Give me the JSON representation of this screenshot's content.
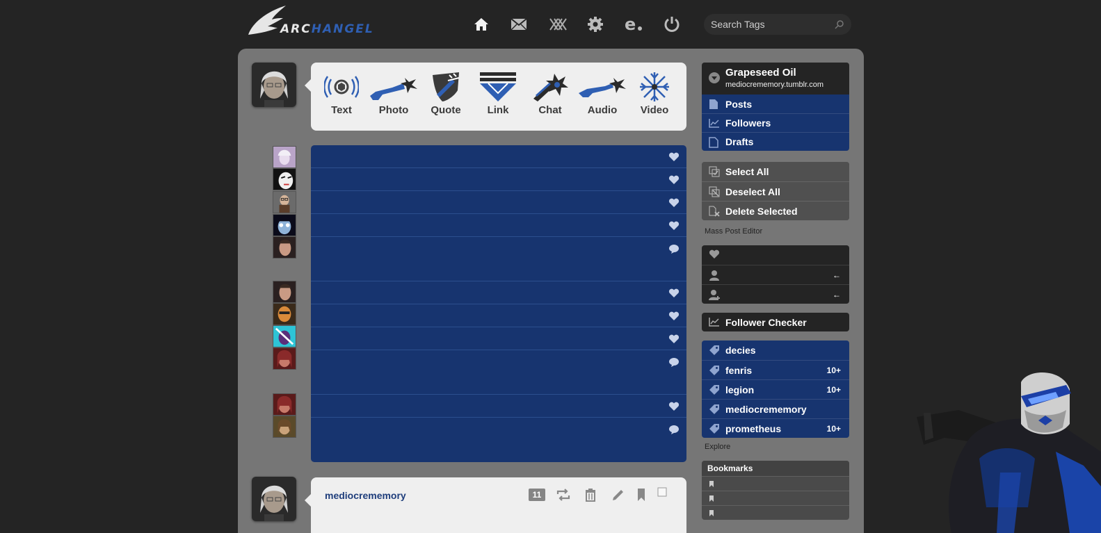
{
  "header": {
    "logo_part1": "ARC",
    "logo_part2": "HANGEL",
    "nav": [
      "home-icon",
      "mail-icon",
      "xkit-icon",
      "gear-icon",
      "e-icon",
      "power-icon"
    ],
    "search_placeholder": "Search Tags"
  },
  "post_types": [
    {
      "label": "Text",
      "icon": "text-icon"
    },
    {
      "label": "Photo",
      "icon": "photo-icon"
    },
    {
      "label": "Quote",
      "icon": "quote-icon"
    },
    {
      "label": "Link",
      "icon": "link-icon"
    },
    {
      "label": "Chat",
      "icon": "chat-icon"
    },
    {
      "label": "Audio",
      "icon": "audio-icon"
    },
    {
      "label": "Video",
      "icon": "video-icon"
    }
  ],
  "activity": [
    {
      "type": "like"
    },
    {
      "type": "like"
    },
    {
      "type": "like"
    },
    {
      "type": "like"
    },
    {
      "type": "reply"
    },
    {
      "type": "like"
    },
    {
      "type": "like"
    },
    {
      "type": "like"
    },
    {
      "type": "reply"
    },
    {
      "type": "like"
    },
    {
      "type": "reply"
    }
  ],
  "post": {
    "username": "mediocrememory",
    "notes_count": "11"
  },
  "sidebar": {
    "blog_title": "Grapeseed Oil",
    "blog_url": "mediocrememory.tumblr.com",
    "blog_menu": [
      "Posts",
      "Followers",
      "Drafts"
    ],
    "mass_editor": [
      "Select All",
      "Deselect All",
      "Delete Selected"
    ],
    "mass_editor_caption": "Mass Post Editor",
    "follower_checker": "Follower Checker",
    "tags": [
      {
        "name": "decies",
        "badge": ""
      },
      {
        "name": "fenris",
        "badge": "10+"
      },
      {
        "name": "legion",
        "badge": "10+"
      },
      {
        "name": "mediocrememory",
        "badge": ""
      },
      {
        "name": "prometheus",
        "badge": "10+"
      }
    ],
    "explore_caption": "Explore",
    "bookmarks_title": "Bookmarks"
  },
  "colors": {
    "accent": "#17346f",
    "panel": "#767676",
    "dark": "#242424"
  }
}
